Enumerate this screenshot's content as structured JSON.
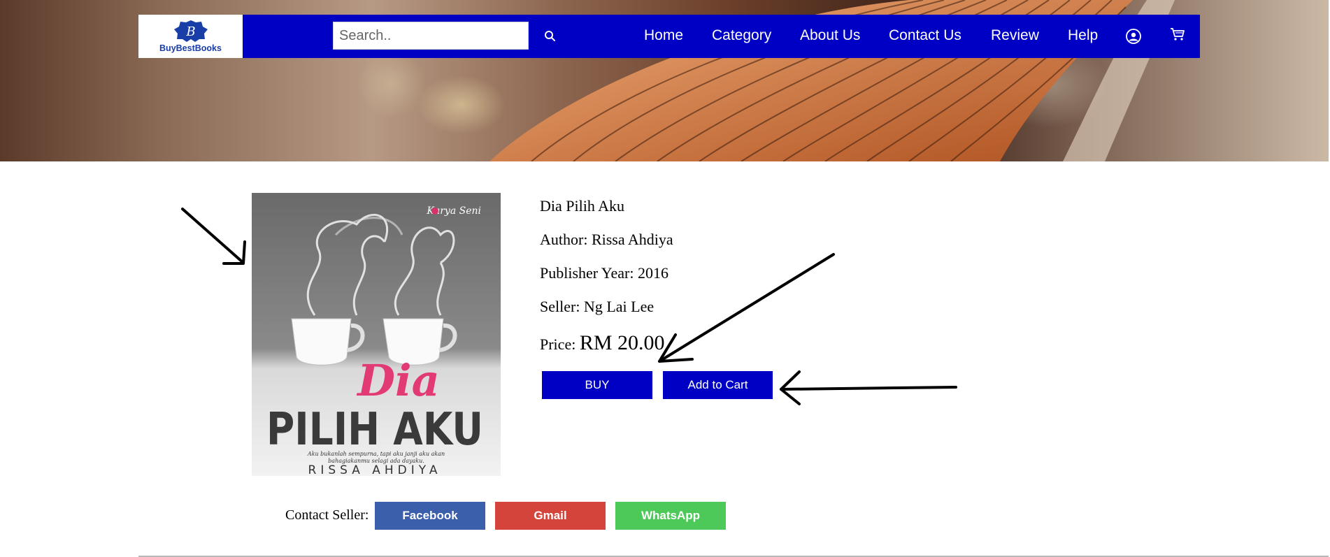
{
  "header": {
    "logo": {
      "brand": "BuyBestBooks",
      "badge_letter": "B"
    },
    "search": {
      "placeholder": "Search..",
      "value": ""
    },
    "nav": {
      "home": "Home",
      "category": "Category",
      "about": "About Us",
      "contact": "Contact Us",
      "review": "Review",
      "help": "Help"
    },
    "icons": {
      "search": "search-icon",
      "account": "user-circle-icon",
      "cart": "cart-icon"
    }
  },
  "product": {
    "cover": {
      "publisher_mark": "Karya Seni",
      "title_line1": "Dia",
      "title_line2": "PILIH AKU",
      "tagline_line1": "Aku bukanlah sempurna, tapi aku janji aku akan",
      "tagline_line2": "bahagiakanmu selagi ada dayaku.",
      "author": "RISSA AHDIYA"
    },
    "title": "Dia Pilih Aku",
    "author": "Author: Rissa Ahdiya",
    "year": "Publisher Year: 2016",
    "seller": "Seller: Ng Lai Lee",
    "price_label": "Price:",
    "price_value": "RM 20.00",
    "buy_label": "BUY",
    "cart_label": "Add to Cart"
  },
  "contact": {
    "label": "Contact Seller:",
    "facebook": "Facebook",
    "gmail": "Gmail",
    "whatsapp": "WhatsApp"
  },
  "colors": {
    "navbar": "#0000c4",
    "primary_button": "#0000c4",
    "facebook": "#3c5fab",
    "gmail": "#d5443a",
    "whatsapp": "#4dc95a"
  }
}
